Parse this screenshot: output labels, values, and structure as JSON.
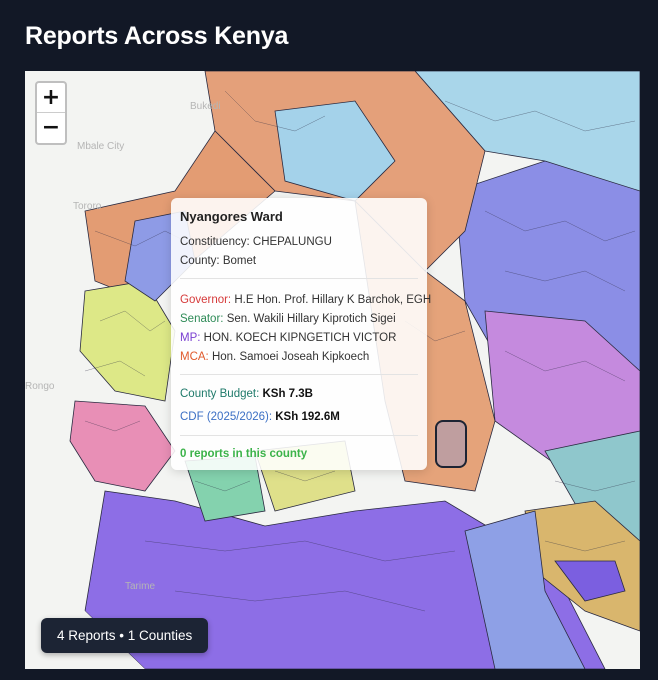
{
  "page": {
    "title": "Reports Across Kenya"
  },
  "zoom": {
    "in_label": "+",
    "out_label": "−"
  },
  "map_places": [
    "Bukedi",
    "Mbale City",
    "Tororo",
    "Rongo",
    "Tarime"
  ],
  "popup": {
    "ward": "Nyangores Ward",
    "constituency_label": "Constituency:",
    "constituency": "CHEPALUNGU",
    "county_label": "County:",
    "county": "Bomet",
    "governor_label": "Governor:",
    "governor": "H.E Hon. Prof. Hillary K Barchok, EGH",
    "senator_label": "Senator:",
    "senator": "Sen. Wakili Hillary Kiprotich Sigei",
    "mp_label": "MP:",
    "mp": "HON. KOECH KIPNGETICH VICTOR",
    "mca_label": "MCA:",
    "mca": "Hon. Samoei Joseah Kipkoech",
    "budget_label": "County Budget:",
    "budget": "KSh 7.3B",
    "cdf_label": "CDF (2025/2026):",
    "cdf": "KSh 192.6M",
    "reports_text": "0 reports in this county"
  },
  "badge": {
    "text": "4 Reports • 1 Counties"
  },
  "colors": {
    "background": "#121826",
    "region_palette": [
      "#e49a73",
      "#9a8ce6",
      "#a7d3e8",
      "#dde887",
      "#c488de",
      "#84d1ad",
      "#e98eb5",
      "#8c6de3",
      "#dcb56c",
      "#b8a2dc"
    ]
  }
}
